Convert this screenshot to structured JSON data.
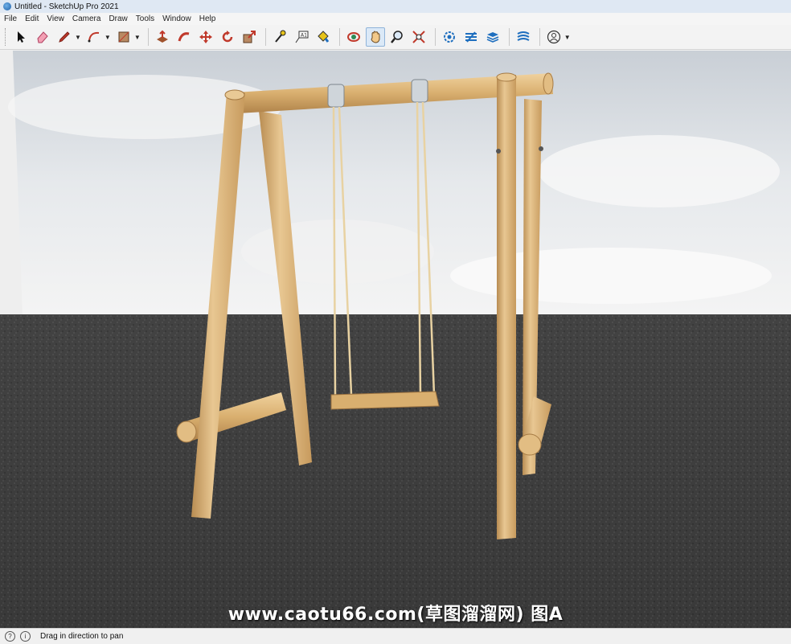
{
  "window": {
    "title": "Untitled - SketchUp Pro 2021"
  },
  "menu": {
    "items": [
      "File",
      "Edit",
      "View",
      "Camera",
      "Draw",
      "Tools",
      "Window",
      "Help"
    ]
  },
  "toolbar": {
    "tools": [
      "select-icon",
      "eraser-icon",
      "pencil-line-icon",
      "arc-icon",
      "shape-rectangle-icon",
      "push-pull-icon",
      "follow-me-icon",
      "move-icon",
      "rotate-icon",
      "scale-icon",
      "tape-measure-icon",
      "text-icon",
      "paint-bucket-icon",
      "orbit-icon",
      "pan-icon",
      "zoom-icon",
      "zoom-extents-icon",
      "warehouse-icon",
      "extension-warehouse-icon",
      "layers-icon",
      "sandbox-icon",
      "account-icon"
    ],
    "active_tool": "pan-icon"
  },
  "scene": {
    "watermark": "www.caotu66.com(草图溜溜网) 图A"
  },
  "status": {
    "message": "Drag in direction to pan",
    "info_icon": "info-icon",
    "geo_icon": "geolocation-icon"
  },
  "colors": {
    "sky": "#e9ecef",
    "ground": "#3d3d3d",
    "wood": "#d9b47a",
    "accent": "#1d5fa6"
  }
}
